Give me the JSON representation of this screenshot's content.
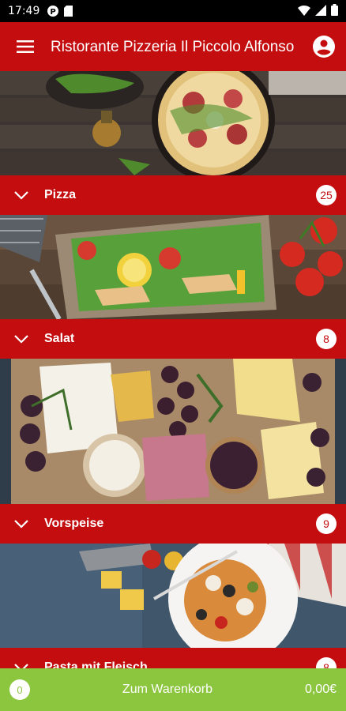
{
  "status_bar": {
    "time": "17:49",
    "icons_left": [
      "notification-p-icon",
      "sim-card-icon"
    ],
    "icons_right": [
      "wifi-icon",
      "signal-icon",
      "battery-icon"
    ]
  },
  "app_bar": {
    "title": "Ristorante Pizzeria Il Piccolo Alfonso",
    "menu_icon": "hamburger-menu-icon",
    "account_icon": "account-circle-icon"
  },
  "colors": {
    "primary": "#c30d0f",
    "cart_bar": "#8cc63f",
    "status_bar": "#000000"
  },
  "categories": [
    {
      "label": "Pizza",
      "count": "25"
    },
    {
      "label": "Salat",
      "count": "8"
    },
    {
      "label": "Vorspeise",
      "count": "9"
    },
    {
      "label": "Pasta mit Fleisch",
      "count": "8"
    }
  ],
  "cart": {
    "count": "0",
    "label": "Zum Warenkorb",
    "total": "0,00€"
  }
}
